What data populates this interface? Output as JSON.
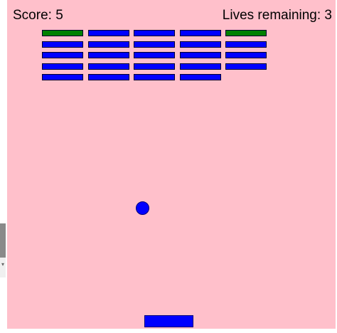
{
  "hud": {
    "score_text": "Score: 5",
    "lives_text": "Lives remaining: 3"
  },
  "colors": {
    "canvas_background": "#ffc0cb",
    "brick_intact": "#0000ff",
    "brick_special": "#008000",
    "ball": "#0000ff",
    "paddle": "#0000ff",
    "text": "#000000"
  },
  "bricks": [
    [
      "green",
      "blue",
      "blue",
      "blue",
      "green"
    ],
    [
      "blue",
      "blue",
      "blue",
      "blue",
      "blue"
    ],
    [
      "blue",
      "blue",
      "blue",
      "blue",
      "blue"
    ],
    [
      "blue",
      "blue",
      "blue",
      "blue",
      "blue"
    ],
    [
      "blue",
      "blue",
      "blue",
      "blue",
      "none"
    ]
  ],
  "icons": {
    "scroll_arrow": "scroll-down-arrow-icon"
  }
}
